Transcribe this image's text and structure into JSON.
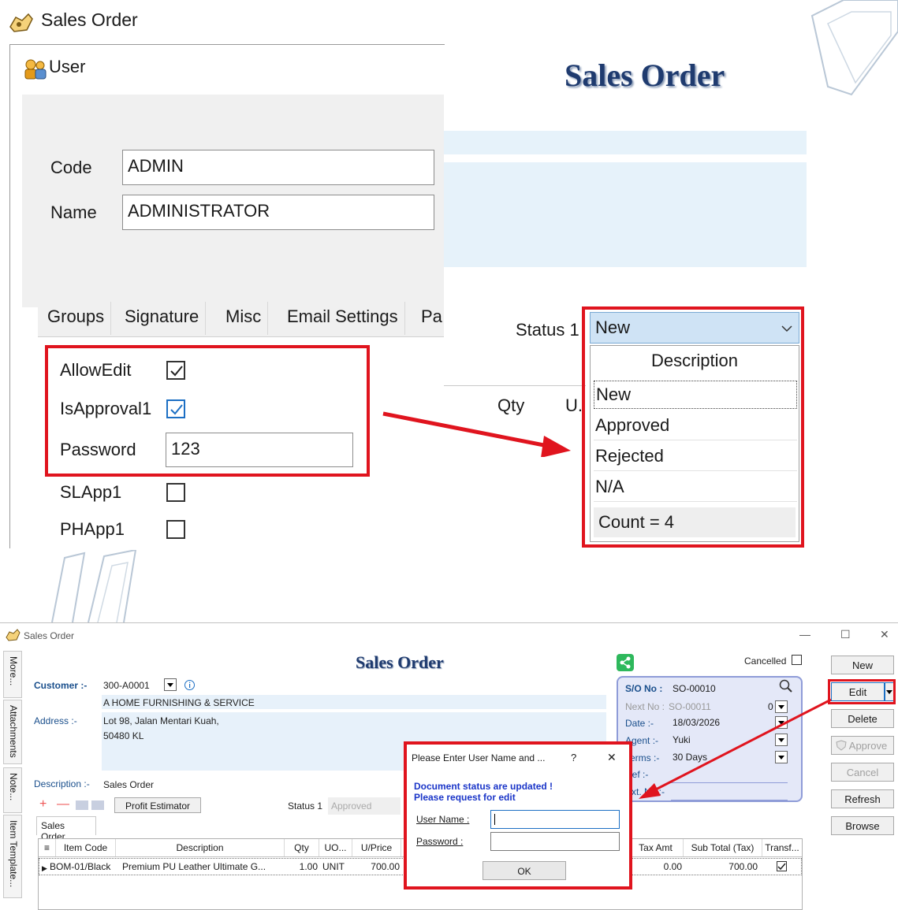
{
  "top": {
    "window_title": "Sales Order",
    "user_panel_title": "User",
    "code_label": "Code",
    "code_value": "ADMIN",
    "name_label": "Name",
    "name_value": "ADMINISTRATOR",
    "tabs": [
      "Groups",
      "Signature",
      "Misc",
      "Email Settings",
      "Pa"
    ],
    "fields": [
      {
        "label": "AllowEdit",
        "checked": true
      },
      {
        "label": "IsApproval1",
        "checked": true
      },
      {
        "label": "Password",
        "value": "123"
      },
      {
        "label": "SLApp1",
        "checked": false
      },
      {
        "label": "PHApp1",
        "checked": false
      }
    ],
    "so_title": "Sales Order",
    "status_label": "Status 1",
    "status_value": "New",
    "grid_qty": "Qty",
    "grid_u": "U.",
    "dropdown": {
      "header": "Description",
      "items": [
        "New",
        "Approved",
        "Rejected",
        "N/A"
      ],
      "count": "Count = 4"
    },
    "accent": "#e0141e"
  },
  "window": {
    "title": "Sales Order",
    "controls": [
      "—",
      "☐",
      "✕"
    ],
    "side_tabs": [
      "More...",
      "Attachments",
      "Note...",
      "Item Template..."
    ],
    "so_title": "Sales Order",
    "cancelled_label": "Cancelled",
    "customer_label": "Customer :-",
    "customer_code": "300-A0001",
    "customer_name": "A HOME FURNISHING & SERVICE",
    "address_label": "Address :-",
    "address_line1": "Lot 98, Jalan Mentari Kuah,",
    "address_line2": "50480 KL",
    "description_label": "Description :-",
    "description_value": "Sales Order",
    "profit_estimator": "Profit Estimator",
    "status_label": "Status 1",
    "status_value": "Approved",
    "sub_tab": "Sales Order",
    "info": {
      "so_no_label": "S/O No :",
      "so_no": "SO-00010",
      "next_no_label": "Next No :",
      "next_no": "SO-00011",
      "next_no_sel": "0",
      "date_label": "Date :-",
      "date": "18/03/2026",
      "agent_label": "Agent :-",
      "agent": "Yuki",
      "terms_label": "Terms :-",
      "terms": "30 Days",
      "ref_label": "Ref :-",
      "ext_no_label": "Ext. No :-"
    },
    "buttons": {
      "new": "New",
      "edit": "Edit",
      "delete": "Delete",
      "approve": "Approve",
      "cancel": "Cancel",
      "refresh": "Refresh",
      "browse": "Browse"
    },
    "grid": {
      "headers": [
        "Item Code",
        "Description",
        "Qty",
        "UO...",
        "U/Price",
        "Tax Amt",
        "Sub Total (Tax)",
        "Transf..."
      ],
      "row": {
        "item_code": "BOM-01/Black",
        "description": "Premium PU Leather Ultimate G...",
        "qty": "1.00",
        "uom": "UNIT",
        "uprice": "700.00",
        "tax_amt": "0.00",
        "sub_total": "700.00",
        "transferable": true
      }
    },
    "dialog": {
      "title": "Please Enter User Name and ...",
      "help": "?",
      "close": "✕",
      "message1": "Document status are updated !",
      "message2": "Please request for edit",
      "username_label": "User Name :",
      "password_label": "Password :",
      "ok": "OK"
    }
  }
}
